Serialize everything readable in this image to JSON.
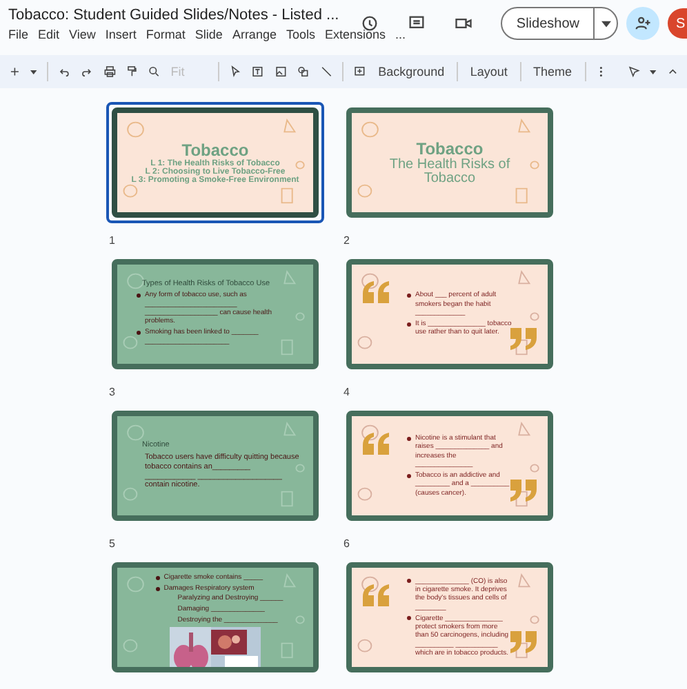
{
  "doc": {
    "title": "Tobacco: Student Guided Slides/Notes  - Listed ...",
    "menus": [
      "File",
      "Edit",
      "View",
      "Insert",
      "Format",
      "Slide",
      "Arrange",
      "Tools",
      "Extensions",
      "..."
    ],
    "slideshow": "Slideshow",
    "avatar": "S"
  },
  "toolbar": {
    "zoom": "Fit",
    "buttons": [
      "Background",
      "Layout",
      "Theme"
    ]
  },
  "slides": [
    {
      "number": "1",
      "selected": true,
      "kind": "title",
      "heading": "Tobacco",
      "lines": [
        "L 1: The Health Risks of Tobacco",
        "L 2: Choosing to Live Tobacco-Free",
        "L 3: Promoting a Smoke-Free Environment"
      ]
    },
    {
      "number": "2",
      "selected": false,
      "kind": "title",
      "heading": "Tobacco",
      "lines": [
        "The Health Risks of Tobacco"
      ]
    },
    {
      "number": "3",
      "selected": false,
      "kind": "green",
      "heading": "Types of Health Risks of Tobacco Use",
      "bullets": [
        {
          "text": "Any form of tobacco use, such as ________________________ ___________________ can cause health problems."
        },
        {
          "text": "Smoking has been linked to _______ ______________________"
        }
      ]
    },
    {
      "number": "4",
      "selected": false,
      "kind": "quote",
      "bullets": [
        {
          "text": "About ___ percent of adult smokers began the habit _____________"
        },
        {
          "text": "It is _______________ tobacco use rather than to quit later."
        }
      ]
    },
    {
      "number": "5",
      "selected": false,
      "kind": "green",
      "heading": "Nicotine",
      "paragraph": "Tobacco users have difficulty quitting because tobacco contains an_________ ____________ ____________________ contain nicotine."
    },
    {
      "number": "6",
      "selected": false,
      "kind": "quote",
      "bullets": [
        {
          "text": "Nicotine is a stimulant that raises ______________ and increases the _______________"
        },
        {
          "text": "Tobacco is an addictive and _________ and a __________ (causes cancer)."
        }
      ]
    },
    {
      "selected": false,
      "kind": "green",
      "bullets": [
        {
          "text": "Cigarette smoke contains _____"
        },
        {
          "text": "Damages Respiratory system",
          "children": [
            {
              "text": "Paralyzing and Destroying ______"
            },
            {
              "text": "Damaging ______________"
            },
            {
              "text": "Destroying the ______________"
            }
          ]
        }
      ],
      "picture": {
        "kind": "picture"
      }
    },
    {
      "selected": false,
      "kind": "quote",
      "bullets": [
        {
          "text": "______________ (CO) is also in cigarette smoke.  It deprives the body's tissues and cells of ________"
        },
        {
          "text": "Cigarette _______________ protect smokers from more than 50 carcinogens, including __________ ___________ which are in tobacco products."
        }
      ]
    }
  ]
}
